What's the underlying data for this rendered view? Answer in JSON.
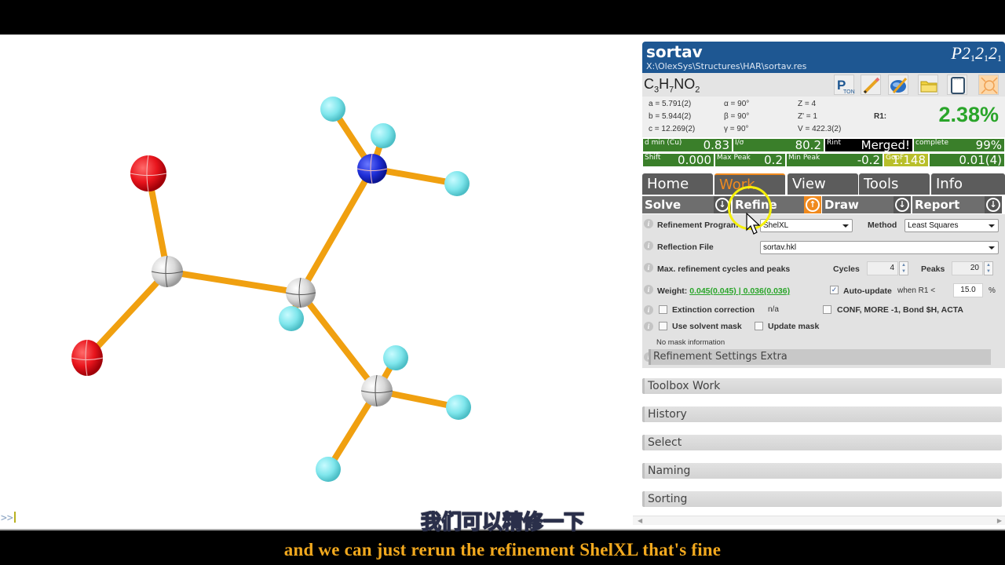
{
  "header": {
    "title": "sortav",
    "path": "X:\\OlexSys\\Structures\\HAR\\sortav.res",
    "space_group": {
      "letter": "P",
      "parts": [
        "2",
        "1",
        "2",
        "1",
        "2",
        "1"
      ]
    }
  },
  "formula": {
    "parts": [
      "C",
      "3",
      "H",
      "7",
      "NO",
      "2"
    ]
  },
  "toolbar_icons": [
    "platon-icon",
    "pencil-icon",
    "edit-structure-icon",
    "folder-icon",
    "notepad-icon",
    "fit-screen-icon"
  ],
  "cell": {
    "a": "a = 5.791(2)",
    "b": "b = 5.944(2)",
    "c": "c = 12.269(2)",
    "alpha": "α = 90°",
    "beta": "β = 90°",
    "gamma": "γ = 90°",
    "z": "Z = 4",
    "zprime": "Z' = 1",
    "v": "V = 422.3(2)",
    "r1_label": "R1:",
    "r1_value": "2.38%"
  },
  "stats_row1": [
    {
      "label": "d min (Cu)",
      "value": "0.83",
      "color": "#3a7f2a"
    },
    {
      "label": "I/σ",
      "value": "80.2",
      "color": "#3a7f2a"
    },
    {
      "label": "Rint",
      "value": "Merged!",
      "color": "#000000"
    },
    {
      "label": "complete",
      "value": "99%",
      "color": "#3a7f2a"
    }
  ],
  "stats_row2": [
    {
      "label": "Shift",
      "value": "0.000",
      "color": "#3a7f2a"
    },
    {
      "label": "Max Peak",
      "value": "0.2",
      "color": "#3a7f2a"
    },
    {
      "label": "Min Peak",
      "value": "-0.2",
      "color": "#3a7f2a"
    },
    {
      "label": "GooF",
      "value": "1.148",
      "color": "#b8bf2a"
    },
    {
      "label": "",
      "value": "0.01(4)",
      "color": "#3a7f2a"
    }
  ],
  "tabs": [
    {
      "label": "Home",
      "active": false
    },
    {
      "label": "Work",
      "active": true
    },
    {
      "label": "View",
      "active": false
    },
    {
      "label": "Tools",
      "active": false
    },
    {
      "label": "Info",
      "active": false
    }
  ],
  "sections": [
    {
      "label": "Solve",
      "active": false
    },
    {
      "label": "Refine",
      "active": true
    },
    {
      "label": "Draw",
      "active": false
    },
    {
      "label": "Report",
      "active": false
    }
  ],
  "refine": {
    "program_label": "Refinement Program",
    "program_value": "ShelXL",
    "method_label": "Method",
    "method_value": "Least Squares",
    "reflection_label": "Reflection File",
    "reflection_value": "sortav.hkl",
    "cycles_peaks_label": "Max. refinement cycles and peaks",
    "cycles_label": "Cycles",
    "cycles_value": "4",
    "peaks_label": "Peaks",
    "peaks_value": "20",
    "weight_label": "Weight:",
    "weight_link1": "0.045(0.045)",
    "weight_sep": " | ",
    "weight_link2": "0.036(0.036)",
    "autoupdate_checked": true,
    "autoupdate_label": "Auto-update",
    "autoupdate_when": "when R1 <",
    "autoupdate_value": "15.0",
    "autoupdate_unit": "%",
    "extinction_label": "Extinction correction",
    "extinction_value": "n/a",
    "conf_label": "CONF, MORE -1, Bond $H, ACTA",
    "solvent_mask_label": "Use solvent mask",
    "update_mask_label": "Update mask",
    "mask_info": "No mask information",
    "extra_label": "Refinement Settings Extra"
  },
  "folds": [
    "Toolbox Work",
    "History",
    "Select",
    "Naming",
    "Sorting"
  ],
  "console": {
    "prompt": ">>"
  },
  "subtitles": {
    "chinese": "我们可以精修一下",
    "english": "and we can just rerun the refinement ShelXL that's fine"
  },
  "molecule": {
    "colors": {
      "O": "#e8141c",
      "N": "#1f2fd8",
      "C": "#d8d8d8",
      "H": "#7fe6ec",
      "bond": "#f0a010"
    },
    "atoms": [
      {
        "id": "O1",
        "el": "O"
      },
      {
        "id": "O2",
        "el": "O"
      },
      {
        "id": "C1",
        "el": "C"
      },
      {
        "id": "C2",
        "el": "C"
      },
      {
        "id": "C3",
        "el": "C"
      },
      {
        "id": "N1",
        "el": "N"
      },
      {
        "id": "H1",
        "el": "H"
      },
      {
        "id": "H2",
        "el": "H"
      },
      {
        "id": "H3",
        "el": "H"
      },
      {
        "id": "H4",
        "el": "H"
      },
      {
        "id": "H5",
        "el": "H"
      },
      {
        "id": "H6",
        "el": "H"
      },
      {
        "id": "H7",
        "el": "H"
      }
    ],
    "bonds": [
      [
        "O1",
        "C1"
      ],
      [
        "O2",
        "C1"
      ],
      [
        "C1",
        "C2"
      ],
      [
        "C2",
        "N1"
      ],
      [
        "C2",
        "C3"
      ],
      [
        "C2",
        "H4"
      ],
      [
        "N1",
        "H1"
      ],
      [
        "N1",
        "H2"
      ],
      [
        "N1",
        "H3"
      ],
      [
        "C3",
        "H5"
      ],
      [
        "C3",
        "H6"
      ],
      [
        "C3",
        "H7"
      ]
    ]
  }
}
